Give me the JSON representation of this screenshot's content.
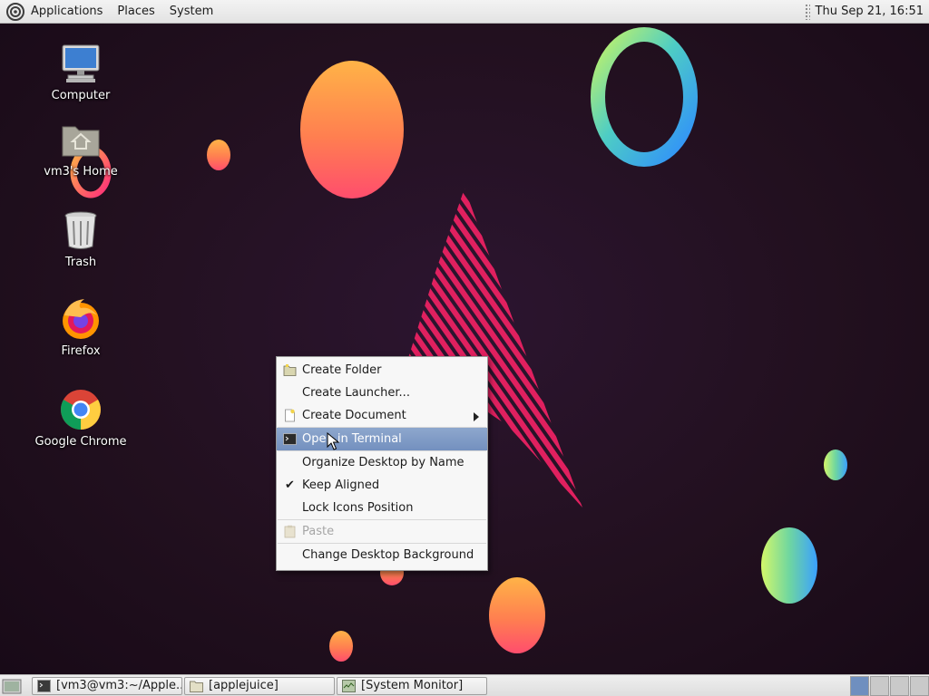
{
  "top_panel": {
    "menus": [
      "Applications",
      "Places",
      "System"
    ],
    "clock": "Thu Sep 21, 16:51"
  },
  "desktop_icons": [
    {
      "label": "Computer",
      "icon": "computer-icon"
    },
    {
      "label": "vm3's Home",
      "icon": "home-folder-icon"
    },
    {
      "label": "Trash",
      "icon": "trash-icon"
    },
    {
      "label": "Firefox",
      "icon": "firefox-icon"
    },
    {
      "label": "Google Chrome",
      "icon": "chrome-icon"
    }
  ],
  "context_menu": {
    "items": [
      {
        "label": "Create Folder",
        "icon": "folder-icon"
      },
      {
        "label": "Create Launcher...",
        "icon": ""
      },
      {
        "label": "Create Document",
        "icon": "document-icon",
        "submenu": true
      },
      {
        "label": "Open in Terminal",
        "icon": "terminal-icon",
        "highlighted": true
      },
      {
        "label": "Organize Desktop by Name",
        "icon": ""
      },
      {
        "label": "Keep Aligned",
        "checked": true
      },
      {
        "label": "Lock Icons Position",
        "icon": ""
      },
      {
        "label": "Paste",
        "icon": "paste-icon",
        "disabled": true
      },
      {
        "label": "Change Desktop Background",
        "icon": ""
      }
    ],
    "check_mark": "✔"
  },
  "taskbar": {
    "tasks": [
      {
        "label": "[vm3@vm3:~/Apple...",
        "icon": "terminal-icon"
      },
      {
        "label": "[applejuice]",
        "icon": "folder-icon"
      },
      {
        "label": "[System Monitor]",
        "icon": "system-monitor-icon"
      }
    ],
    "workspaces": 4,
    "active_workspace": 1
  },
  "colors": {
    "wallpaper_bg": "#22101f",
    "menu_highlight": "#7d99c6",
    "panel_bg": "#e9e9e9"
  }
}
